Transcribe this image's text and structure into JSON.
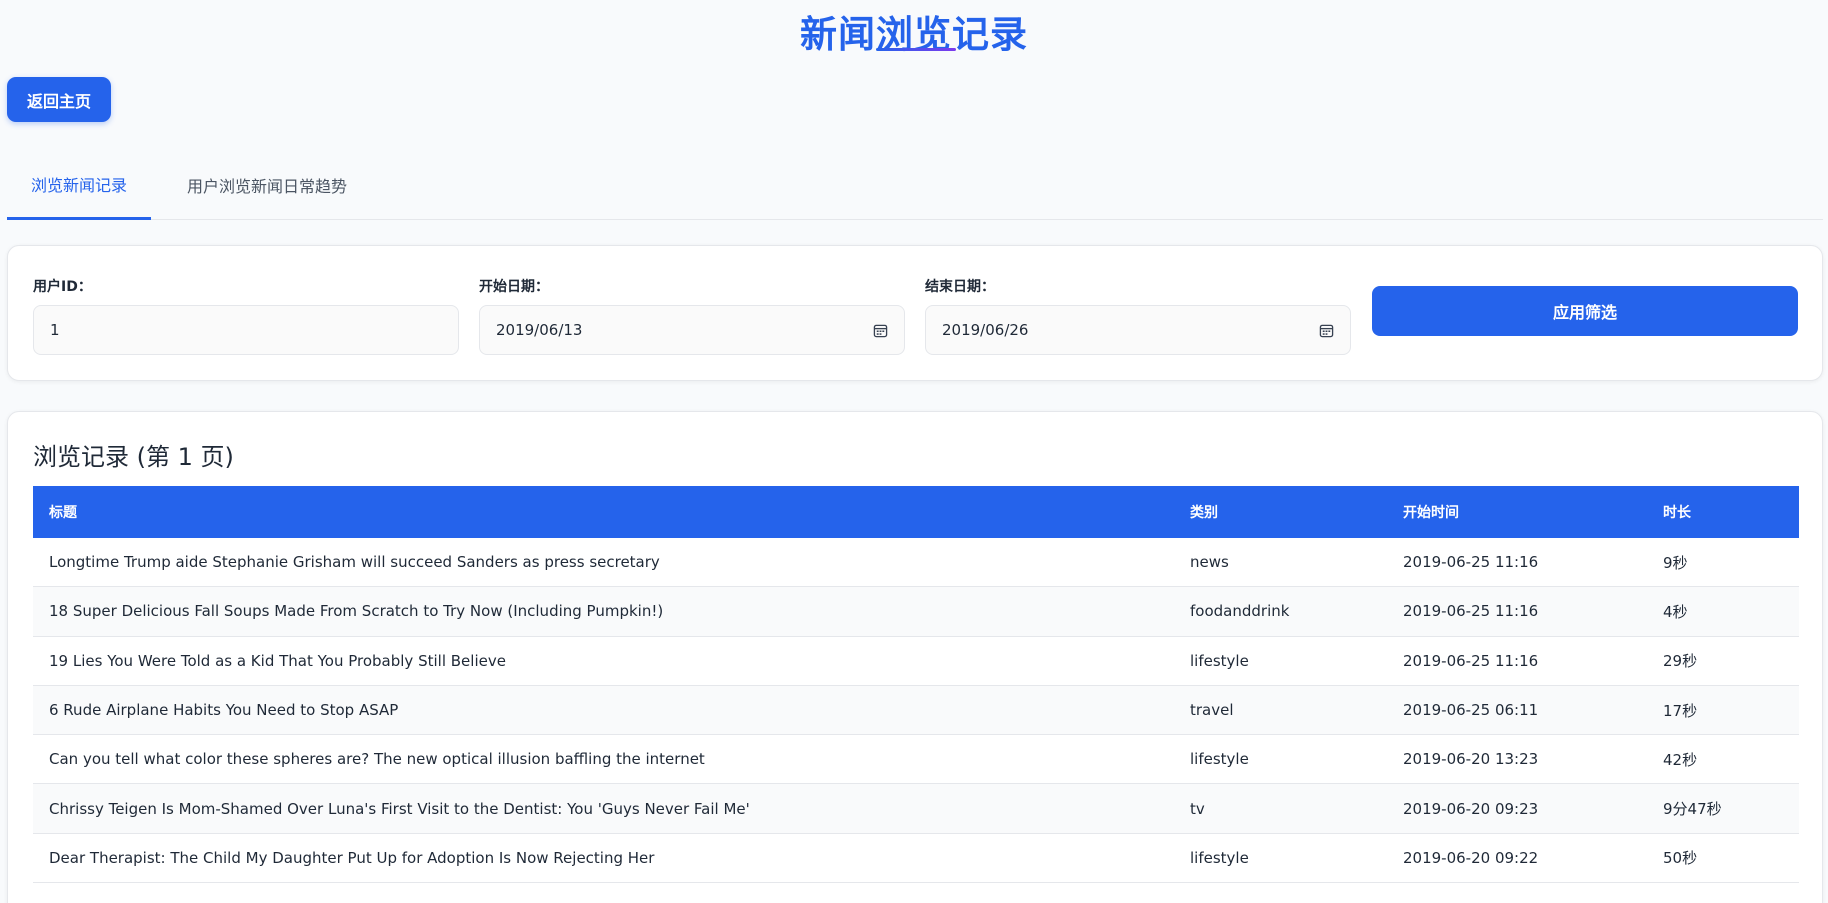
{
  "header": {
    "title": "新闻浏览记录",
    "back_label": "返回主页"
  },
  "tabs": [
    {
      "label": "浏览新闻记录",
      "active": true
    },
    {
      "label": "用户浏览新闻日常趋势",
      "active": false
    }
  ],
  "filters": {
    "user_id_label": "用户ID：",
    "user_id_value": "1",
    "start_label": "开始日期：",
    "start_value": "2019/06/13",
    "end_label": "结束日期：",
    "end_value": "2019/06/26",
    "apply_label": "应用筛选"
  },
  "records": {
    "title": "浏览记录 (第 1 页)",
    "columns": [
      "标题",
      "类别",
      "开始时间",
      "时长"
    ],
    "rows": [
      {
        "title": "Longtime Trump aide Stephanie Grisham will succeed Sanders as press secretary",
        "category": "news",
        "start": "2019-06-25 11:16",
        "duration": "9秒"
      },
      {
        "title": "18 Super Delicious Fall Soups Made From Scratch to Try Now (Including Pumpkin!)",
        "category": "foodanddrink",
        "start": "2019-06-25 11:16",
        "duration": "4秒"
      },
      {
        "title": "19 Lies You Were Told as a Kid That You Probably Still Believe",
        "category": "lifestyle",
        "start": "2019-06-25 11:16",
        "duration": "29秒"
      },
      {
        "title": "6 Rude Airplane Habits You Need to Stop ASAP",
        "category": "travel",
        "start": "2019-06-25 06:11",
        "duration": "17秒"
      },
      {
        "title": "Can you tell what color these spheres are? The new optical illusion baffling the internet",
        "category": "lifestyle",
        "start": "2019-06-20 13:23",
        "duration": "42秒"
      },
      {
        "title": "Chrissy Teigen Is Mom-Shamed Over Luna's First Visit to the Dentist: You 'Guys Never Fail Me'",
        "category": "tv",
        "start": "2019-06-20 09:23",
        "duration": "9分47秒"
      },
      {
        "title": "Dear Therapist: The Child My Daughter Put Up for Adoption Is Now Rejecting Her",
        "category": "lifestyle",
        "start": "2019-06-20 09:22",
        "duration": "50秒"
      }
    ]
  },
  "colors": {
    "accent": "#2563eb",
    "background": "#f8fafc"
  }
}
